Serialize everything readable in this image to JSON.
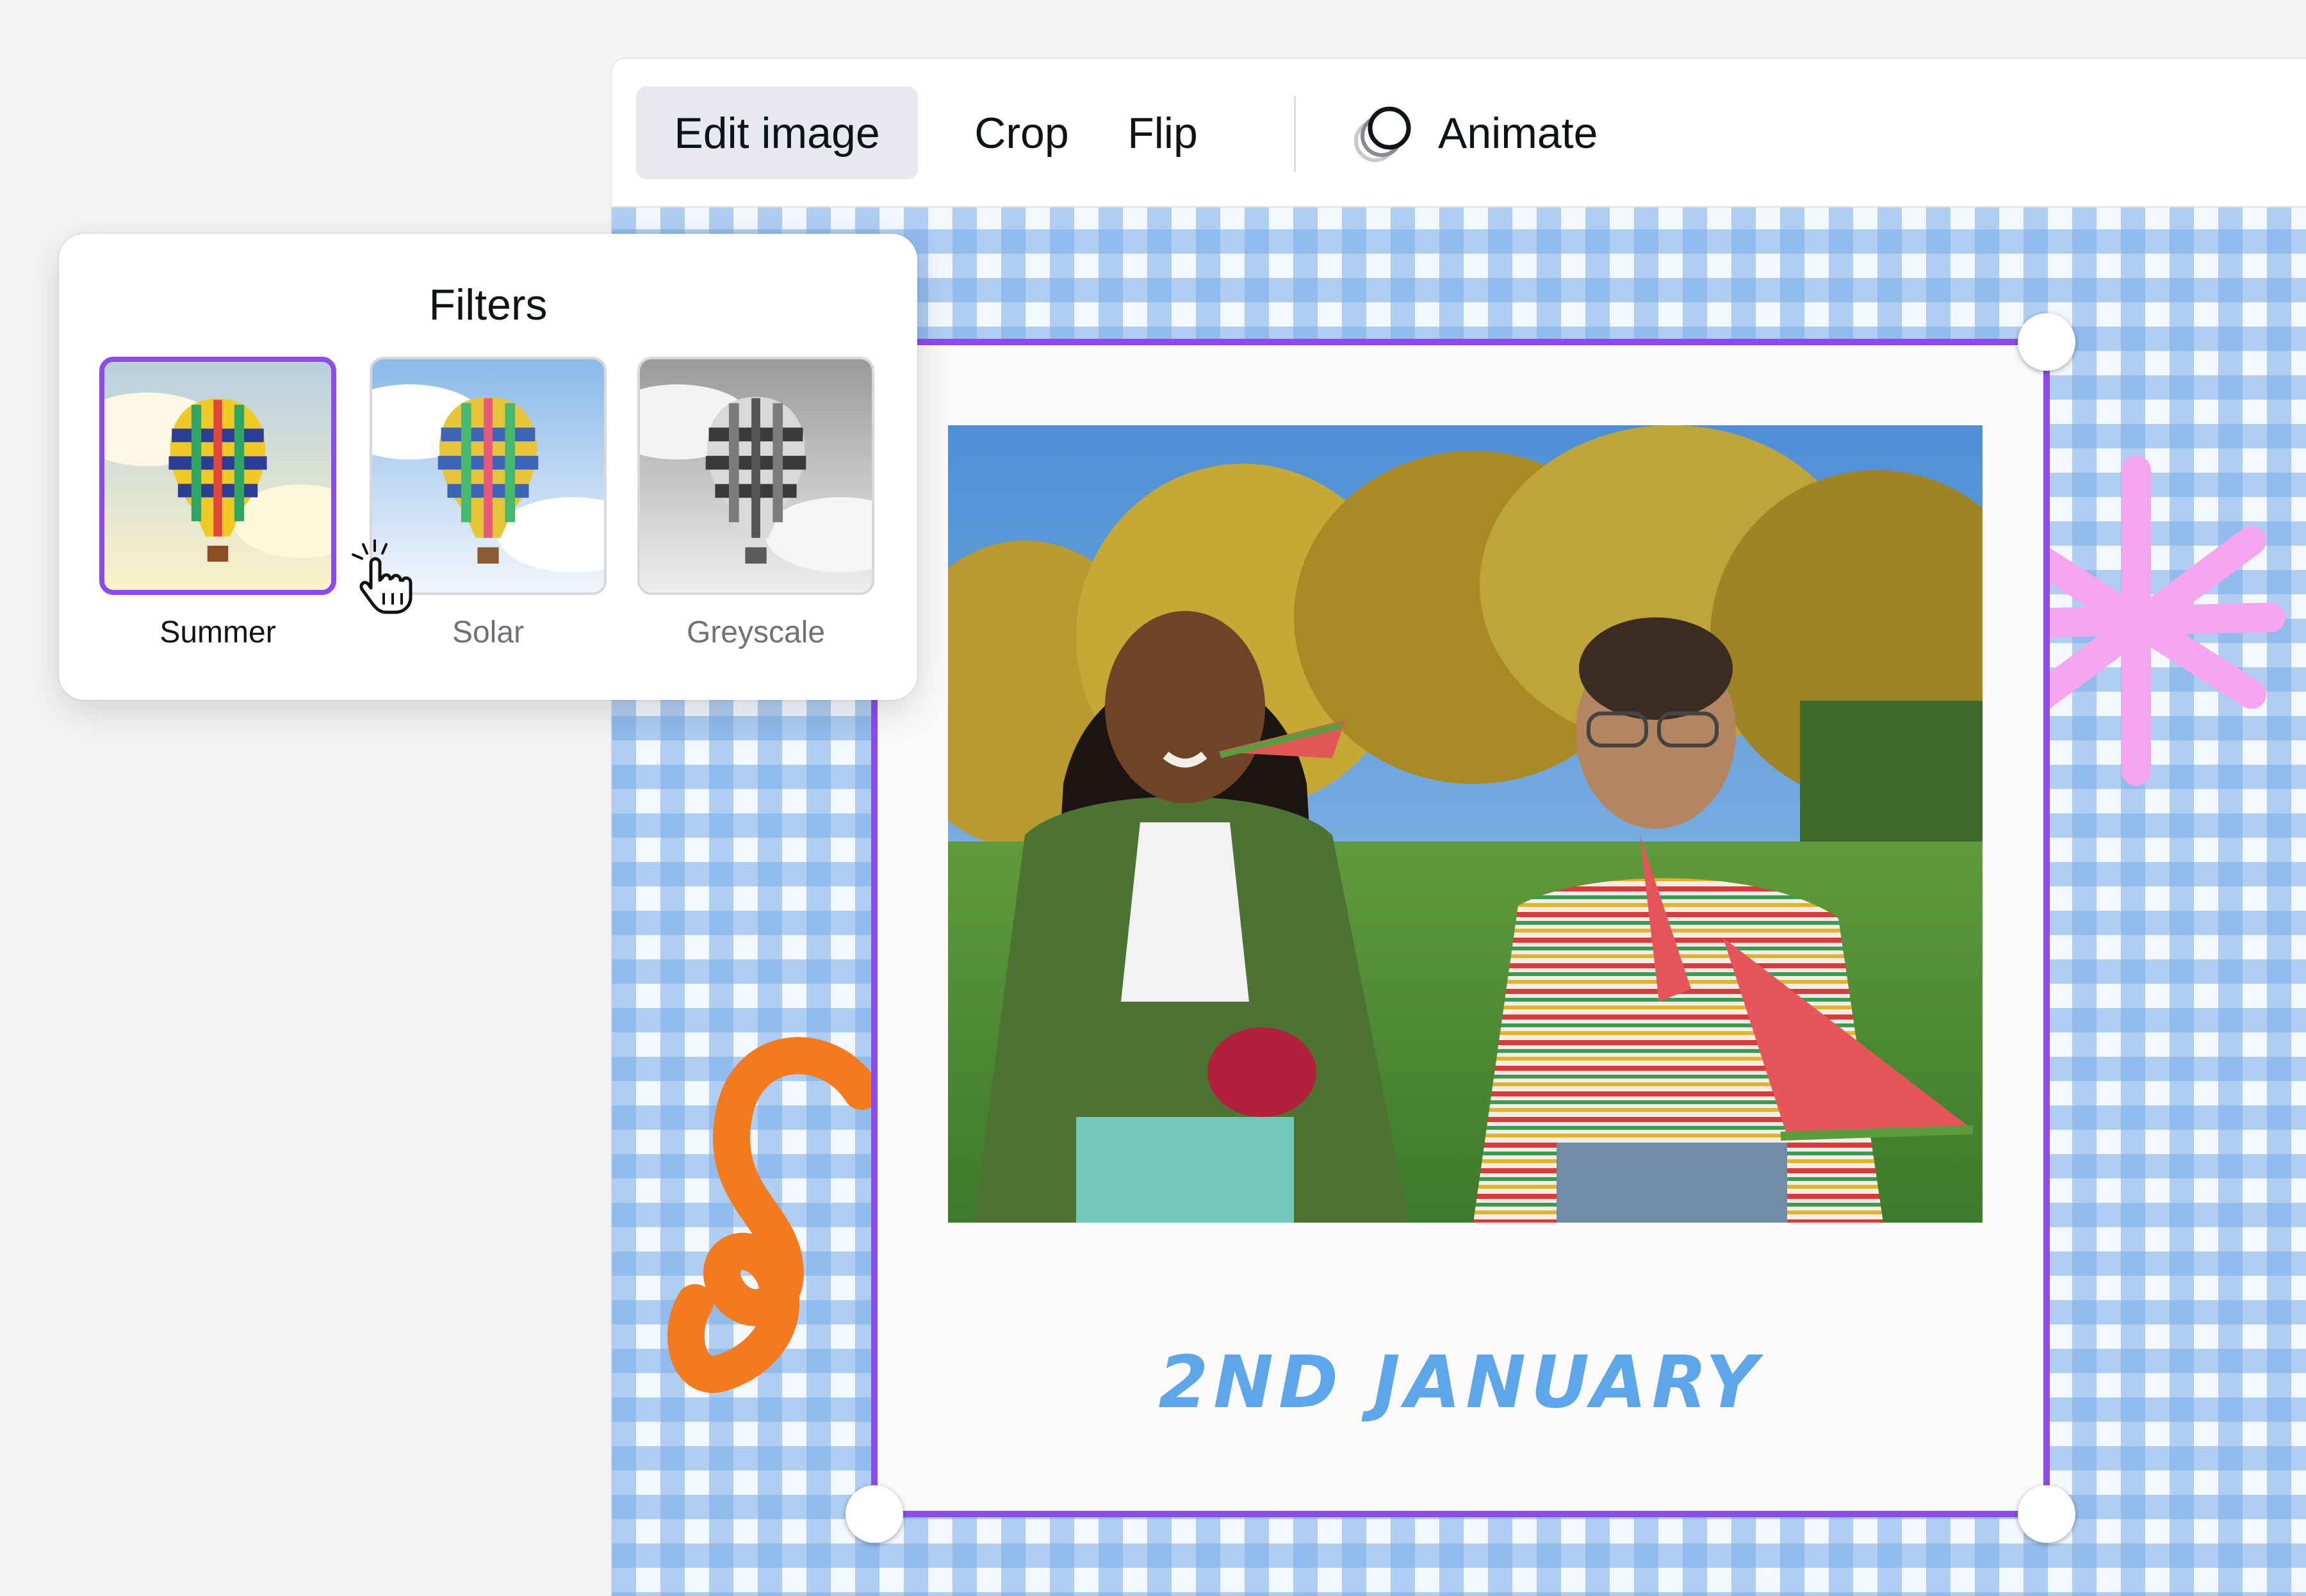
{
  "toolbar": {
    "edit_image_label": "Edit image",
    "crop_label": "Crop",
    "flip_label": "Flip",
    "animate_label": "Animate"
  },
  "filters_panel": {
    "title": "Filters",
    "options": [
      {
        "label": "Summer",
        "selected": true
      },
      {
        "label": "Solar",
        "selected": false
      },
      {
        "label": "Greyscale",
        "selected": false
      }
    ]
  },
  "canvas": {
    "caption": "2ND JANUARY"
  },
  "colors": {
    "selection_accent": "#8c4bea",
    "caption_blue": "#5ea6ea",
    "gingham_blue": "#78ace8",
    "sticker_orange": "#f47a1f",
    "sticker_pink": "#f5a6ef"
  },
  "icons": {
    "animate": "animate-circles-icon",
    "cursor": "hand-pointer-cursor-icon"
  }
}
